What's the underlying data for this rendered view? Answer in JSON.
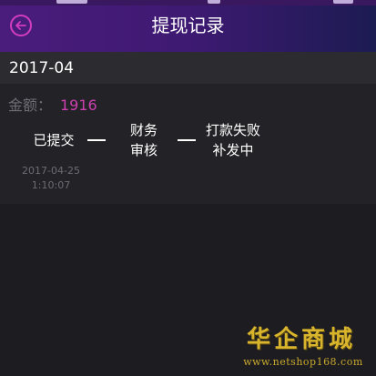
{
  "nav": {
    "title": "提现记录"
  },
  "section": {
    "month": "2017-04"
  },
  "record": {
    "amount_label": "金额：",
    "amount_value": "1916",
    "steps": [
      {
        "lines": [
          "已提交"
        ],
        "time_lines": [
          "2017-04-25",
          "1:10:07"
        ]
      },
      {
        "lines": [
          "财务",
          "审核"
        ]
      },
      {
        "lines": [
          "打款失败",
          "补发中"
        ]
      }
    ]
  },
  "watermark": {
    "logo_text": "华企商城",
    "url": "www.netshop168.com"
  },
  "colors": {
    "accent": "#cc3fae",
    "nav_gradient_start": "#4a1c7c",
    "nav_gradient_end": "#1c1b52",
    "background": "#1d1c21",
    "card": "#232227",
    "watermark": "#d9b52d"
  },
  "icons": {
    "back": "back-arrow-circle-icon"
  }
}
